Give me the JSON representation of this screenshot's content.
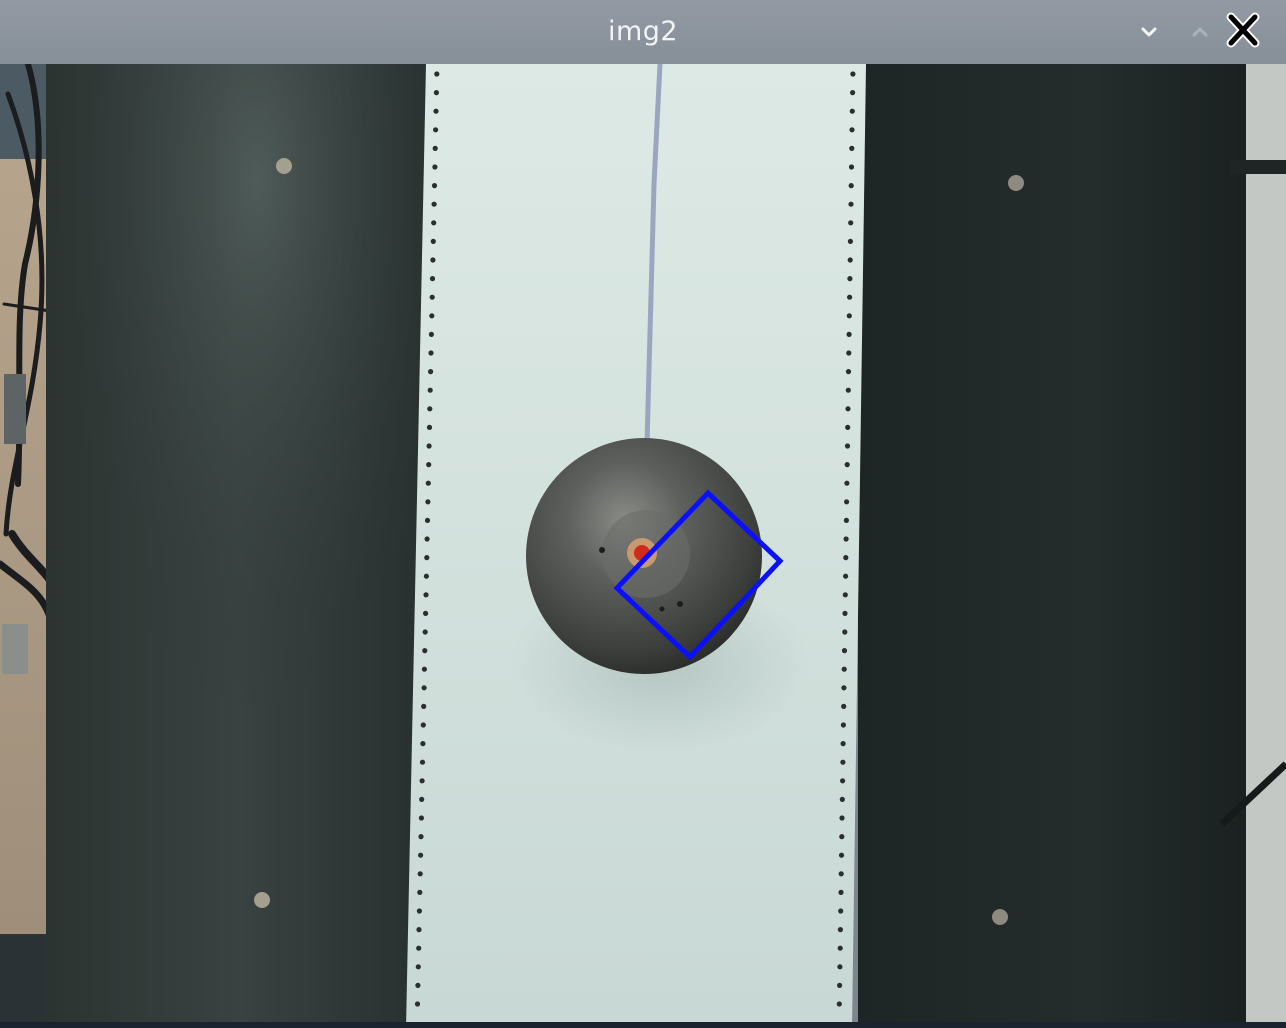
{
  "window": {
    "title": "img2",
    "controls": {
      "minimize_icon": "chevron-down-icon",
      "maximize_icon": "chevron-up-icon",
      "close_icon": "close-icon"
    }
  },
  "image_view": {
    "description_colors": {
      "overlay": "#0a10ff",
      "marker": "#d02a1c"
    }
  }
}
